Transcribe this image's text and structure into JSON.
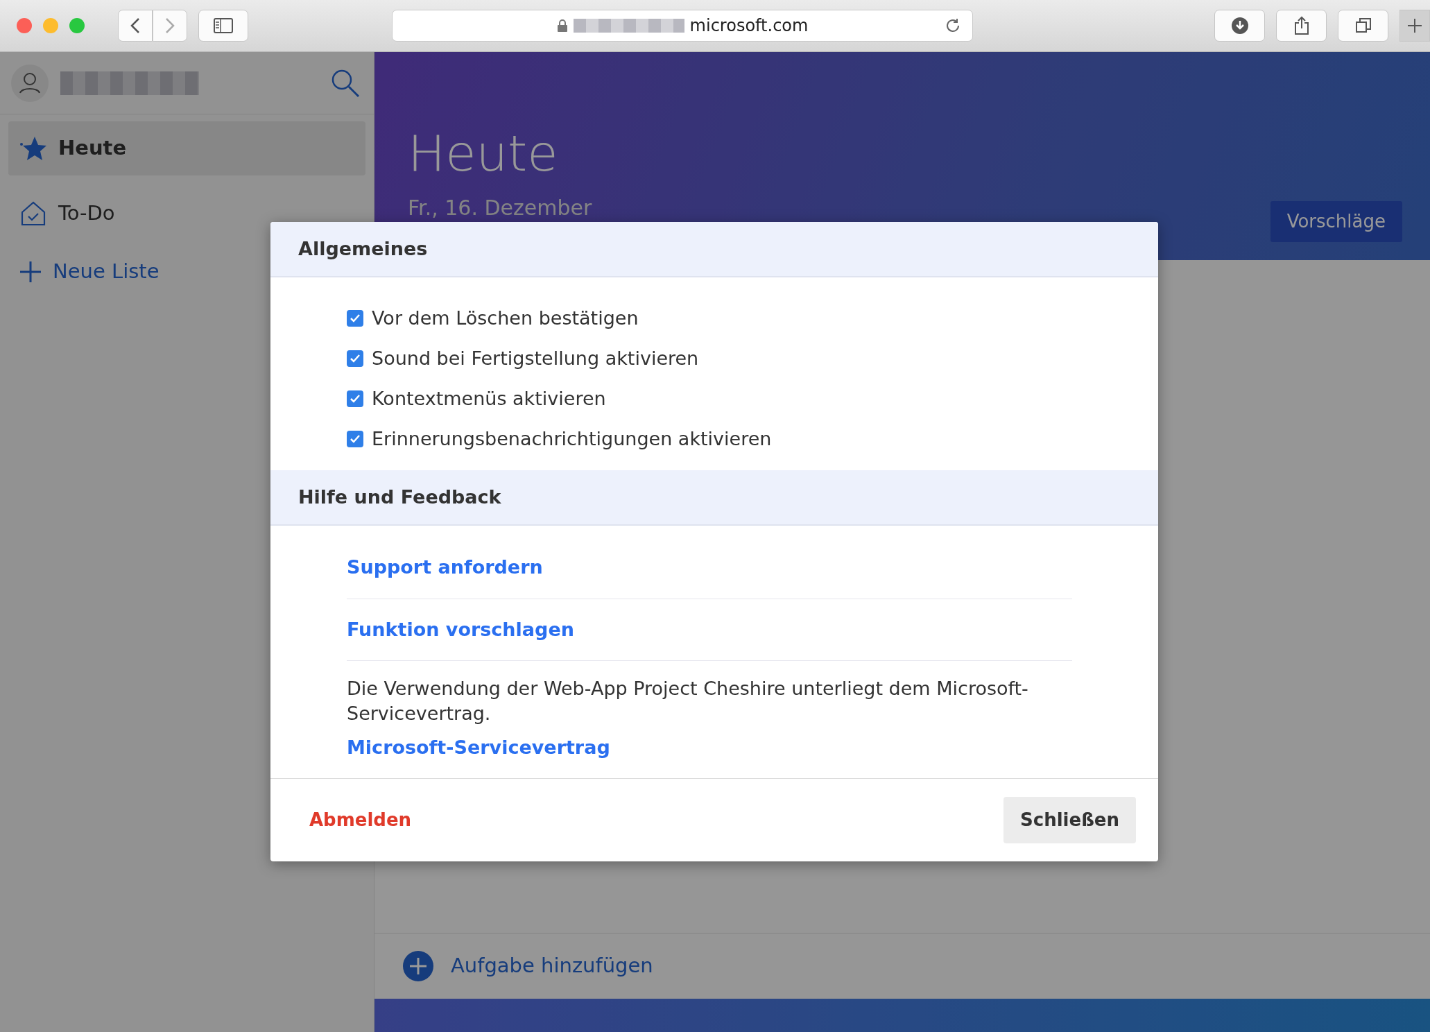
{
  "browser": {
    "address": "microsoft.com"
  },
  "sidebar": {
    "items": [
      {
        "label": "Heute",
        "kind": "star",
        "selected": true
      },
      {
        "label": "To-Do",
        "kind": "home",
        "selected": false
      }
    ],
    "new_list": "Neue Liste"
  },
  "main": {
    "title": "Heute",
    "date": "Fr., 16. Dezember",
    "suggestions_button": "Vorschläge",
    "add_task": "Aufgabe hinzufügen"
  },
  "dialog": {
    "general": {
      "title": "Allgemeines",
      "options": [
        {
          "label": "Vor dem Löschen bestätigen",
          "checked": true
        },
        {
          "label": "Sound bei Fertigstellung aktivieren",
          "checked": true
        },
        {
          "label": "Kontextmenüs aktivieren",
          "checked": true
        },
        {
          "label": "Erinnerungsbenachrichtigungen aktivieren",
          "checked": true
        }
      ]
    },
    "help": {
      "title": "Hilfe und Feedback",
      "links": [
        "Support anfordern",
        "Funktion vorschlagen"
      ],
      "notice": "Die Verwendung der Web-App Project Cheshire unterliegt dem Microsoft-Servicevertrag.",
      "notice_link": "Microsoft-Servicevertrag"
    },
    "sign_out": "Abmelden",
    "close": "Schließen"
  }
}
